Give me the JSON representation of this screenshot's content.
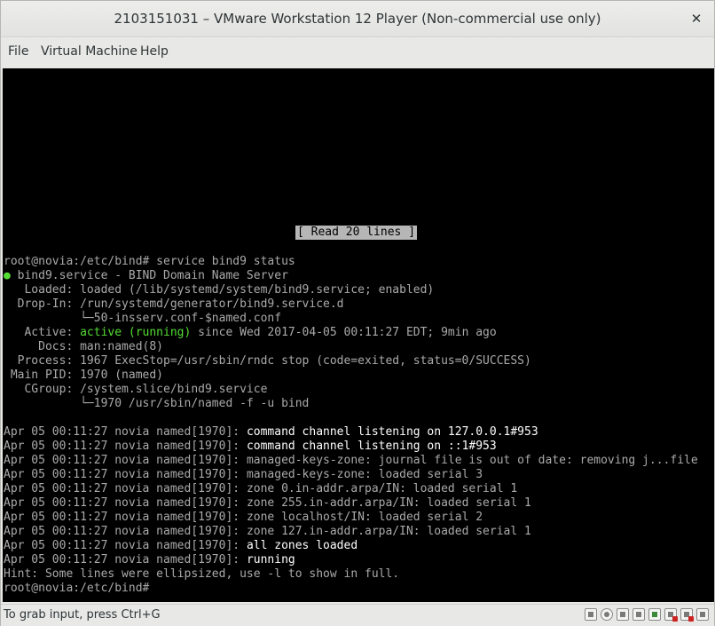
{
  "window": {
    "title": "2103151031 – VMware Workstation 12 Player (Non-commercial use only)",
    "close_glyph": "✕"
  },
  "menubar": {
    "items": [
      "File",
      "Virtual Machine",
      "Help"
    ]
  },
  "console": {
    "banner": "[ Read 20 lines ]",
    "lines": {
      "prompt_cmd": "root@novia:/etc/bind# service bind9 status",
      "bullet": "●",
      "unit": " bind9.service - BIND Domain Name Server",
      "loaded": "   Loaded: loaded (/lib/systemd/system/bind9.service; enabled)",
      "dropin": "  Drop-In: /run/systemd/generator/bind9.service.d",
      "dropin_file": "           └─50-insserv.conf-$named.conf",
      "active_label": "   Active: ",
      "active_state": "active (running)",
      "active_rest": " since Wed 2017-04-05 00:11:27 EDT; 9min ago",
      "docs": "     Docs: man:named(8)",
      "process": "  Process: 1967 ExecStop=/usr/sbin/rndc stop (code=exited, status=0/SUCCESS)",
      "mainpid": " Main PID: 1970 (named)",
      "cgroup": "   CGroup: /system.slice/bind9.service",
      "cgroup_proc": "           └─1970 /usr/sbin/named -f -u bind",
      "blank": " ",
      "log_prefix": "Apr 05 00:11:27 novia named[1970]: ",
      "log1": "command channel listening on 127.0.0.1#953",
      "log2": "command channel listening on ::1#953",
      "log3": "managed-keys-zone: journal file is out of date: removing j...file",
      "log4": "managed-keys-zone: loaded serial 3",
      "log5": "zone 0.in-addr.arpa/IN: loaded serial 1",
      "log6": "zone 255.in-addr.arpa/IN: loaded serial 1",
      "log7": "zone localhost/IN: loaded serial 2",
      "log8": "zone 127.in-addr.arpa/IN: loaded serial 1",
      "log9": "all zones loaded",
      "log10": "running",
      "hint": "Hint: Some lines were ellipsized, use -l to show in full.",
      "prompt_end": "root@novia:/etc/bind#"
    }
  },
  "statusbar": {
    "text": "To grab input, press Ctrl+G",
    "device_icons": [
      "hard-disk-icon",
      "cd-dvd-icon",
      "network-adapter-icon",
      "floppy-icon",
      "usb-icon",
      "sound-card-icon",
      "printer-icon",
      "display-icon"
    ]
  }
}
